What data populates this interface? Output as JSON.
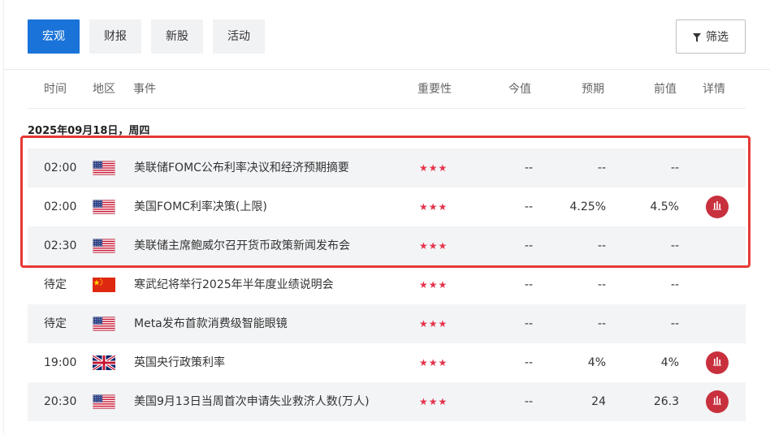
{
  "tabs": [
    {
      "label": "宏观",
      "active": true
    },
    {
      "label": "财报",
      "active": false
    },
    {
      "label": "新股",
      "active": false
    },
    {
      "label": "活动",
      "active": false
    }
  ],
  "filter": {
    "label": "筛选",
    "icon": "filter-icon"
  },
  "columns": {
    "time": "时间",
    "region": "地区",
    "event": "事件",
    "importance": "重要性",
    "actual": "今值",
    "forecast": "预期",
    "previous": "前值",
    "detail": "详情"
  },
  "date_header": "2025年09月18日，周四",
  "colors": {
    "accent": "#1a73d9",
    "star": "#e5334b",
    "detail_button": "#c9303e",
    "highlight": "#e53935"
  },
  "rows": [
    {
      "time": "02:00",
      "flag": "us-flag-icon",
      "event": "美联储FOMC公布利率决议和经济预期摘要",
      "stars": "★★★",
      "actual": "--",
      "forecast": "--",
      "previous": "--",
      "detail": false
    },
    {
      "time": "02:00",
      "flag": "us-flag-icon",
      "event": "美国FOMC利率决策(上限)",
      "stars": "★★★",
      "actual": "--",
      "forecast": "4.25%",
      "previous": "4.5%",
      "detail": true
    },
    {
      "time": "02:30",
      "flag": "us-flag-icon",
      "event": "美联储主席鲍威尔召开货币政策新闻发布会",
      "stars": "★★★",
      "actual": "--",
      "forecast": "--",
      "previous": "--",
      "detail": false
    },
    {
      "time": "待定",
      "flag": "cn-flag-icon",
      "event": "寒武纪将举行2025年半年度业绩说明会",
      "stars": "★★★",
      "actual": "--",
      "forecast": "--",
      "previous": "--",
      "detail": false
    },
    {
      "time": "待定",
      "flag": "us-flag-icon",
      "event": "Meta发布首款消费级智能眼镜",
      "stars": "★★★",
      "actual": "--",
      "forecast": "--",
      "previous": "--",
      "detail": false
    },
    {
      "time": "19:00",
      "flag": "uk-flag-icon",
      "event": "英国央行政策利率",
      "stars": "★★★",
      "actual": "--",
      "forecast": "4%",
      "previous": "4%",
      "detail": true
    },
    {
      "time": "20:30",
      "flag": "us-flag-icon",
      "event": "美国9月13日当周首次申请失业救济人数(万人)",
      "stars": "★★★",
      "actual": "--",
      "forecast": "24",
      "previous": "26.3",
      "detail": true
    }
  ]
}
